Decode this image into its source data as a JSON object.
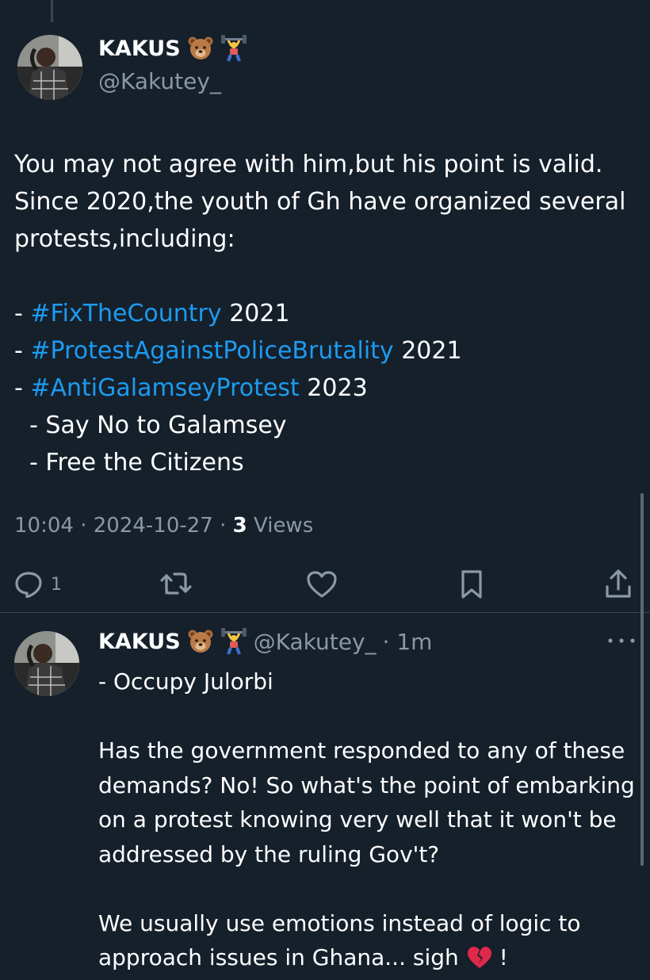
{
  "tweet": {
    "author": {
      "name": "KAKUS",
      "handle": "@Kakutey_",
      "emojis": [
        "bear-emoji",
        "weightlifter-emoji"
      ]
    },
    "text_lines": [
      [
        {
          "text": "You may not agree with him,but his point is valid."
        }
      ],
      [
        {
          "text": "Since 2020,the youth of Gh have organized several"
        }
      ],
      [
        {
          "text": "protests,including:"
        }
      ],
      [
        {
          "text": ""
        }
      ],
      [
        {
          "text": "- "
        },
        {
          "text": "#FixTheCountry",
          "tag": true
        },
        {
          "text": " 2021"
        }
      ],
      [
        {
          "text": "- "
        },
        {
          "text": "#ProtestAgainstPoliceBrutality",
          "tag": true
        },
        {
          "text": " 2021"
        }
      ],
      [
        {
          "text": "- "
        },
        {
          "text": "#AntiGalamseyProtest",
          "tag": true
        },
        {
          "text": " 2023"
        }
      ],
      [
        {
          "text": "  - Say No to Galamsey"
        }
      ],
      [
        {
          "text": "  - Free the Citizens"
        }
      ]
    ],
    "time": "10:04",
    "date": "2024-10-27",
    "views_count": "3",
    "views_label": "Views",
    "separator": "·",
    "actions": {
      "reply_count": "1"
    }
  },
  "reply": {
    "author": {
      "name": "KAKUS",
      "handle": "@Kakutey_",
      "emojis": [
        "bear-emoji",
        "weightlifter-emoji"
      ]
    },
    "time_ago": "· 1m",
    "text_lines": [
      "- Occupy Julorbi",
      "",
      "Has the government responded to any of these",
      "demands? No! So what's the point of embarking",
      "on a protest knowing very well that it won't be",
      "addressed by the ruling Gov't?",
      "",
      "We usually use emotions instead of logic to",
      "approach issues in Ghana... sigh"
    ],
    "trailing_text": " !",
    "trailing_emoji": "broken-heart-emoji"
  },
  "colors": {
    "background": "#15202b",
    "text": "#ffffff",
    "secondary": "#8b98a5",
    "hashtag": "#1d9bf0",
    "divider": "#38444d"
  }
}
